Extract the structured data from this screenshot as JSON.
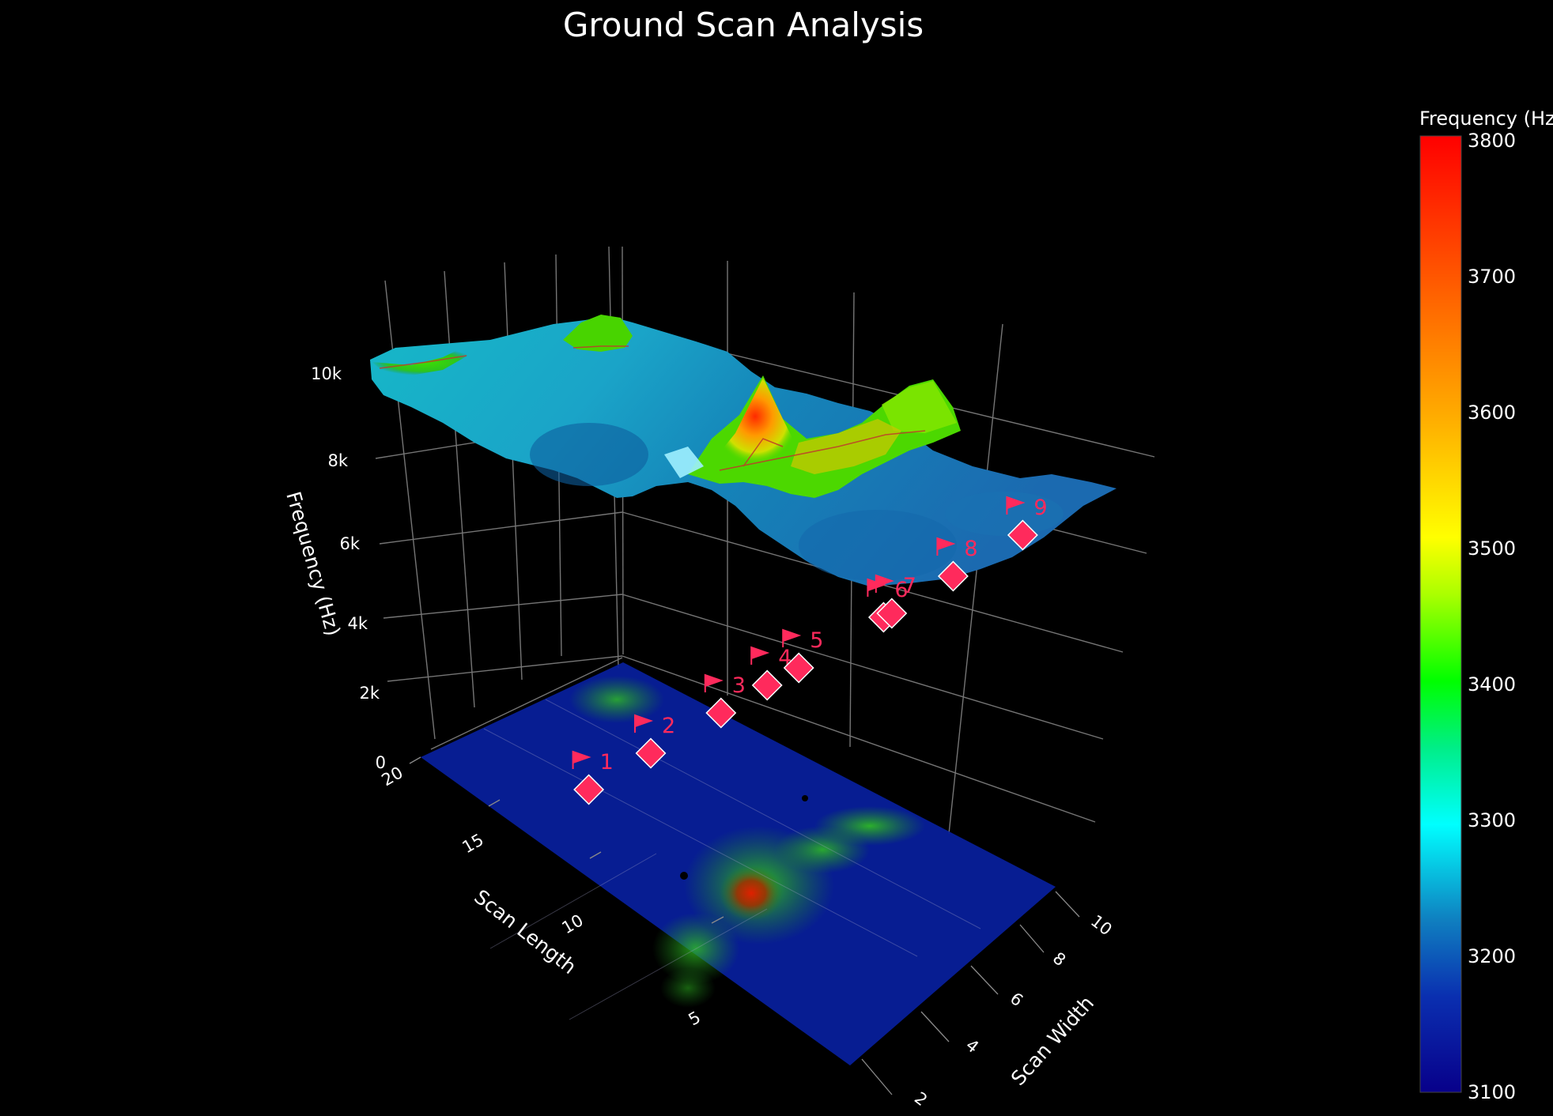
{
  "chart_data": {
    "type": "surface3d",
    "title": "Ground Scan Analysis",
    "axes": {
      "x": {
        "label": "Scan Width",
        "ticks": [
          "2",
          "4",
          "6",
          "8",
          "10"
        ]
      },
      "y": {
        "label": "Scan Length",
        "ticks": [
          "5",
          "10",
          "15",
          "20"
        ]
      },
      "z": {
        "label": "Frequency (Hz)",
        "ticks": [
          "0",
          "2k",
          "4k",
          "6k",
          "8k",
          "10k"
        ]
      }
    },
    "colorbar": {
      "title": "Frequency (Hz)",
      "range": [
        3100,
        3800
      ],
      "ticks": [
        "3100",
        "3200",
        "3300",
        "3400",
        "3500",
        "3600",
        "3700",
        "3800"
      ],
      "colorscale": [
        "#08008a",
        "#0a2fb0",
        "#0f7fc0",
        "#00ffff",
        "#00ee55",
        "#00ff00",
        "#aaff00",
        "#ffff00",
        "#ffb000",
        "#ff6a00",
        "#ff0000"
      ]
    },
    "surface": {
      "z_level_hz": 9500,
      "range_hz": [
        3100,
        3800
      ]
    },
    "floor_projection": {
      "z_level_hz": 0
    },
    "markers": [
      {
        "label": "1",
        "x": 2.2,
        "y": 16.5
      },
      {
        "label": "2",
        "x": 3.0,
        "y": 15.5
      },
      {
        "label": "3",
        "x": 3.6,
        "y": 14.0
      },
      {
        "label": "4",
        "x": 4.4,
        "y": 13.5
      },
      {
        "label": "5",
        "x": 4.4,
        "y": 12.5
      },
      {
        "label": "6",
        "x": 5.8,
        "y": 11.5
      },
      {
        "label": "7",
        "x": 5.6,
        "y": 11.0
      },
      {
        "label": "8",
        "x": 6.8,
        "y": 10.5
      },
      {
        "label": "9",
        "x": 7.8,
        "y": 9.5
      }
    ],
    "marker_color": "#ff2a5c"
  }
}
